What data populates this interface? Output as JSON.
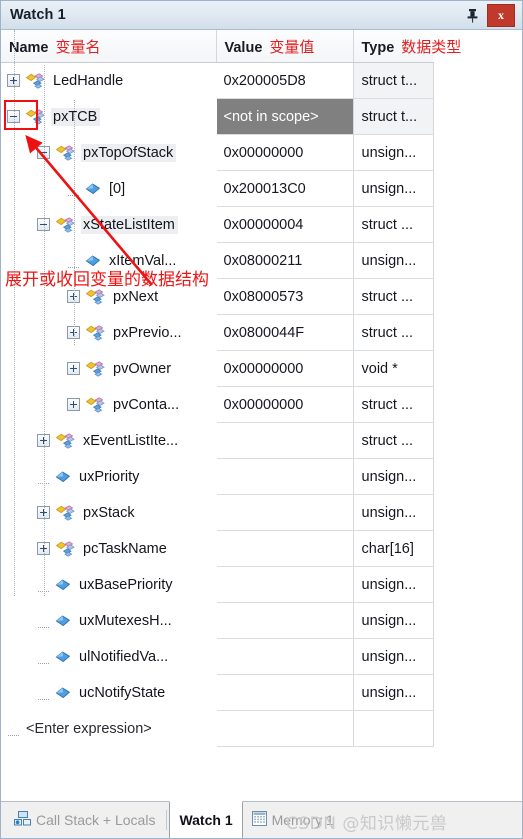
{
  "window": {
    "title": "Watch 1",
    "pin_icon": "pin-icon",
    "close_label": "x"
  },
  "columns": [
    {
      "en": "Name",
      "cn": "变量名"
    },
    {
      "en": "Value",
      "cn": "变量值"
    },
    {
      "en": "Type",
      "cn": "数据类型"
    }
  ],
  "rows": [
    {
      "name": "LedHandle",
      "value": "0x200005D8",
      "type": "struct t...",
      "depth": 0,
      "expander": "plus",
      "icon": "struct-icon",
      "highlight": false,
      "selected": false
    },
    {
      "name": "pxTCB",
      "value": "<not in scope>",
      "type": "struct t...",
      "depth": 0,
      "expander": "minus",
      "icon": "struct-icon",
      "highlight": true,
      "selected": true
    },
    {
      "name": "pxTopOfStack",
      "value": "0x00000000",
      "type": "unsign...",
      "depth": 1,
      "expander": "minus",
      "icon": "struct-icon",
      "highlight": true,
      "selected": false
    },
    {
      "name": "[0]",
      "value": "0x200013C0",
      "type": "unsign...",
      "depth": 2,
      "expander": "none",
      "icon": "var-icon",
      "highlight": false,
      "selected": false
    },
    {
      "name": "xStateListItem",
      "value": "0x00000004",
      "type": "struct ...",
      "depth": 1,
      "expander": "minus",
      "icon": "struct-icon",
      "highlight": true,
      "selected": false
    },
    {
      "name": "xItemVal...",
      "value": "0x08000211",
      "type": "unsign...",
      "depth": 2,
      "expander": "none",
      "icon": "var-icon",
      "highlight": false,
      "selected": false
    },
    {
      "name": "pxNext",
      "value": "0x08000573",
      "type": "struct ...",
      "depth": 2,
      "expander": "plus",
      "icon": "struct-icon",
      "highlight": false,
      "selected": false
    },
    {
      "name": "pxPrevio...",
      "value": "0x0800044F",
      "type": "struct ...",
      "depth": 2,
      "expander": "plus",
      "icon": "struct-icon",
      "highlight": false,
      "selected": false
    },
    {
      "name": "pvOwner",
      "value": "0x00000000",
      "type": "void *",
      "depth": 2,
      "expander": "plus",
      "icon": "struct-icon",
      "highlight": false,
      "selected": false
    },
    {
      "name": "pvConta...",
      "value": "0x00000000",
      "type": "struct ...",
      "depth": 2,
      "expander": "plus",
      "icon": "struct-icon",
      "highlight": false,
      "selected": false
    },
    {
      "name": "xEventListIte...",
      "value": "",
      "type": "struct ...",
      "depth": 1,
      "expander": "plus",
      "icon": "struct-icon",
      "highlight": false,
      "selected": false
    },
    {
      "name": "uxPriority",
      "value": "",
      "type": "unsign...",
      "depth": 1,
      "expander": "none",
      "icon": "var-icon",
      "highlight": false,
      "selected": false
    },
    {
      "name": "pxStack",
      "value": "",
      "type": "unsign...",
      "depth": 1,
      "expander": "plus",
      "icon": "struct-icon",
      "highlight": false,
      "selected": false
    },
    {
      "name": "pcTaskName",
      "value": "",
      "type": "char[16]",
      "depth": 1,
      "expander": "plus",
      "icon": "struct-icon",
      "highlight": false,
      "selected": false
    },
    {
      "name": "uxBasePriority",
      "value": "",
      "type": "unsign...",
      "depth": 1,
      "expander": "none",
      "icon": "var-icon",
      "highlight": false,
      "selected": false
    },
    {
      "name": "uxMutexesH...",
      "value": "",
      "type": "unsign...",
      "depth": 1,
      "expander": "none",
      "icon": "var-icon",
      "highlight": false,
      "selected": false
    },
    {
      "name": "ulNotifiedVa...",
      "value": "",
      "type": "unsign...",
      "depth": 1,
      "expander": "none",
      "icon": "var-icon",
      "highlight": false,
      "selected": false
    },
    {
      "name": "ucNotifyState",
      "value": "",
      "type": "unsign...",
      "depth": 1,
      "expander": "none",
      "icon": "var-icon",
      "highlight": false,
      "selected": false
    },
    {
      "name": "<Enter expression>",
      "value": "",
      "type": "",
      "depth": 0,
      "expander": "none",
      "icon": "none",
      "highlight": false,
      "selected": false
    }
  ],
  "annotations": {
    "expand_note": "展开或收回变量的数据结构",
    "accent_color": "#ee1111"
  },
  "tabs": [
    {
      "label": "Call Stack + Locals",
      "icon": "call-stack-icon",
      "active": false
    },
    {
      "label": "Watch 1",
      "icon": "none",
      "active": true
    },
    {
      "label": "Memory 1",
      "icon": "memory-icon",
      "active": false
    }
  ],
  "watermark": "CSDN @知识懒元兽"
}
